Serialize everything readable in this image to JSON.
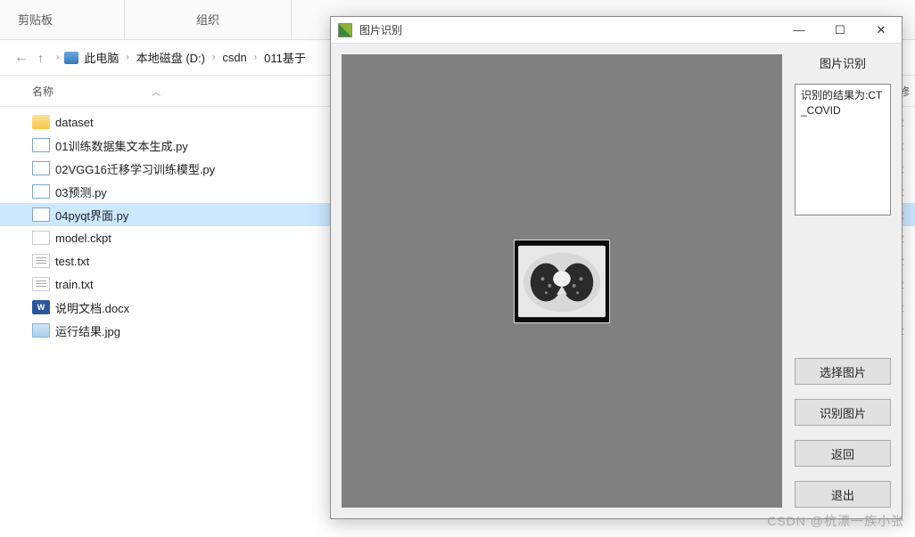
{
  "ribbon": {
    "tabs": [
      "剪贴板",
      "组织"
    ]
  },
  "breadcrumb": {
    "items": [
      "此电脑",
      "本地磁盘 (D:)",
      "csdn",
      "011基于"
    ]
  },
  "columns": {
    "name": "名称",
    "col2_partial": "修"
  },
  "files": [
    {
      "icon": "folder",
      "name": "dataset",
      "col2": "2"
    },
    {
      "icon": "py",
      "name": "01训练数据集文本生成.py",
      "col2": "2"
    },
    {
      "icon": "py",
      "name": "02VGG16迁移学习训练模型.py",
      "col2": "2"
    },
    {
      "icon": "py",
      "name": "03预测.py",
      "col2": "2"
    },
    {
      "icon": "py",
      "name": "04pyqt界面.py",
      "col2": "2",
      "selected": true
    },
    {
      "icon": "ckpt",
      "name": "model.ckpt",
      "col2": "2"
    },
    {
      "icon": "txt",
      "name": "test.txt",
      "col2": "2"
    },
    {
      "icon": "txt",
      "name": "train.txt",
      "col2": "2"
    },
    {
      "icon": "docx",
      "name": "说明文档.docx",
      "col2": "2"
    },
    {
      "icon": "jpg",
      "name": "运行结果.jpg",
      "col2": "2"
    }
  ],
  "dialog": {
    "title": "图片识别",
    "side_title": "图片识别",
    "result_text": "识别的结果为:CT_COVID",
    "buttons": {
      "select": "选择图片",
      "recognize": "识别图片",
      "back": "返回",
      "quit": "退出"
    }
  },
  "watermark": "CSDN @杭漂一族小张"
}
